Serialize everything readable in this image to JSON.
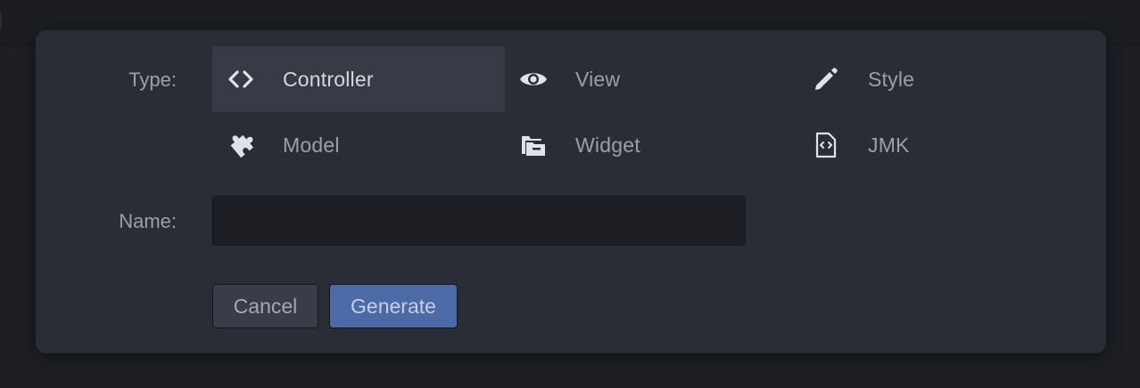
{
  "dialog": {
    "type_label": "Type:",
    "name_label": "Name:",
    "types": [
      {
        "label": "Controller",
        "icon": "code-brackets-icon",
        "selected": true
      },
      {
        "label": "View",
        "icon": "eye-icon",
        "selected": false
      },
      {
        "label": "Style",
        "icon": "pencil-icon",
        "selected": false
      },
      {
        "label": "Model",
        "icon": "puzzle-piece-icon",
        "selected": false
      },
      {
        "label": "Widget",
        "icon": "folder-stack-icon",
        "selected": false
      },
      {
        "label": "JMK",
        "icon": "code-file-icon",
        "selected": false
      }
    ],
    "name_input": {
      "value": "",
      "placeholder": ""
    },
    "cancel_label": "Cancel",
    "generate_label": "Generate"
  },
  "colors": {
    "dialog_bg": "#2a2d36",
    "selected_bg": "#373b46",
    "primary_button": "#4b6aa6",
    "text_muted": "#9aa0ab"
  }
}
